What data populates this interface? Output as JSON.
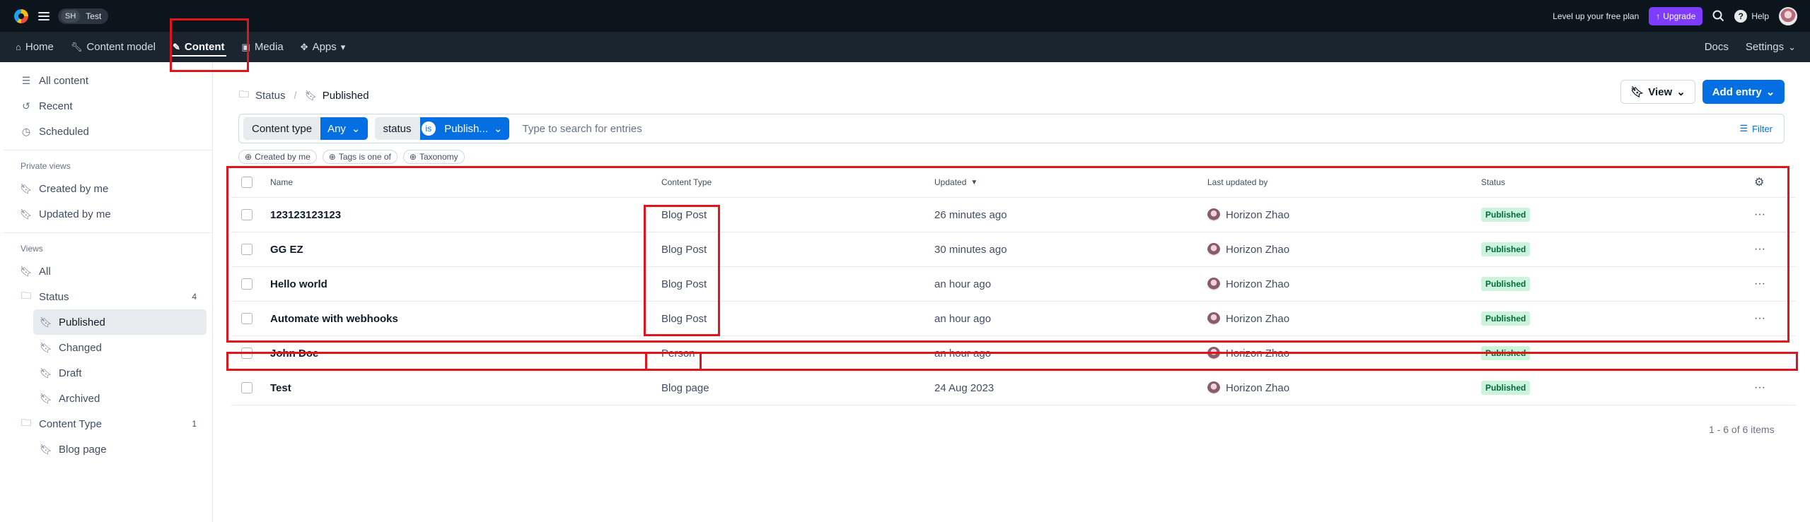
{
  "topbar": {
    "space_initials": "SH",
    "space_name": "Test",
    "upgrade_text": "Level up your free plan",
    "upgrade_button": "Upgrade",
    "help_label": "Help",
    "icons": {
      "logo": "contentful-logo",
      "menu": "hamburger-icon",
      "search": "search-icon",
      "help": "help-circle-icon",
      "avatar": "user-avatar"
    }
  },
  "nav": {
    "items": [
      {
        "label": "Home",
        "icon": "home-icon"
      },
      {
        "label": "Content model",
        "icon": "wrench-icon"
      },
      {
        "label": "Content",
        "icon": "feather-icon",
        "active": true
      },
      {
        "label": "Media",
        "icon": "image-icon"
      },
      {
        "label": "Apps",
        "icon": "puzzle-icon"
      }
    ],
    "docs": "Docs",
    "settings": "Settings"
  },
  "sidebar": {
    "top_items": [
      {
        "label": "All content",
        "icon": "list-icon"
      },
      {
        "label": "Recent",
        "icon": "history-icon"
      },
      {
        "label": "Scheduled",
        "icon": "clock-icon"
      }
    ],
    "private_title": "Private views",
    "private_items": [
      {
        "label": "Created by me"
      },
      {
        "label": "Updated by me"
      }
    ],
    "views_title": "Views",
    "all_label": "All",
    "status_folder": {
      "label": "Status",
      "count": "4"
    },
    "status_items": [
      {
        "label": "Published",
        "active": true
      },
      {
        "label": "Changed"
      },
      {
        "label": "Draft"
      },
      {
        "label": "Archived"
      }
    ],
    "content_type_folder": {
      "label": "Content Type",
      "count": "1"
    },
    "content_type_items": [
      {
        "label": "Blog page"
      }
    ]
  },
  "main": {
    "breadcrumb": {
      "parent": "Status",
      "current": "Published"
    },
    "view_button": "View",
    "add_entry_button": "Add entry",
    "search": {
      "content_type_label": "Content type",
      "content_type_value": "Any",
      "status_label": "status",
      "status_operator": "is",
      "status_value": "Publish...",
      "placeholder": "Type to search for entries",
      "filter_label": "Filter"
    },
    "chips": [
      "Created by me",
      "Tags is one of",
      "Taxonomy"
    ],
    "table": {
      "headers": {
        "name": "Name",
        "content_type": "Content Type",
        "updated": "Updated",
        "updated_by": "Last updated by",
        "status": "Status"
      },
      "rows": [
        {
          "name": "123123123123",
          "content_type": "Blog Post",
          "updated": "26 minutes ago",
          "updated_by": "Horizon Zhao",
          "status": "Published"
        },
        {
          "name": "GG EZ",
          "content_type": "Blog Post",
          "updated": "30 minutes ago",
          "updated_by": "Horizon Zhao",
          "status": "Published"
        },
        {
          "name": "Hello world",
          "content_type": "Blog Post",
          "updated": "an hour ago",
          "updated_by": "Horizon Zhao",
          "status": "Published"
        },
        {
          "name": "Automate with webhooks",
          "content_type": "Blog Post",
          "updated": "an hour ago",
          "updated_by": "Horizon Zhao",
          "status": "Published"
        },
        {
          "name": "John Doe",
          "content_type": "Person",
          "updated": "an hour ago",
          "updated_by": "Horizon Zhao",
          "status": "Published"
        },
        {
          "name": "Test",
          "content_type": "Blog page",
          "updated": "24 Aug 2023",
          "updated_by": "Horizon Zhao",
          "status": "Published"
        }
      ],
      "more_label": "···"
    },
    "pagination": "1 - 6 of 6 items"
  },
  "colors": {
    "topbar": "#0c141c",
    "navbar": "#1b2530",
    "primary": "#036fe3",
    "upgrade": "#7d3cff",
    "badge_bg": "#ccf4dd",
    "badge_text": "#006c3a",
    "annotation": "#e0141c"
  }
}
